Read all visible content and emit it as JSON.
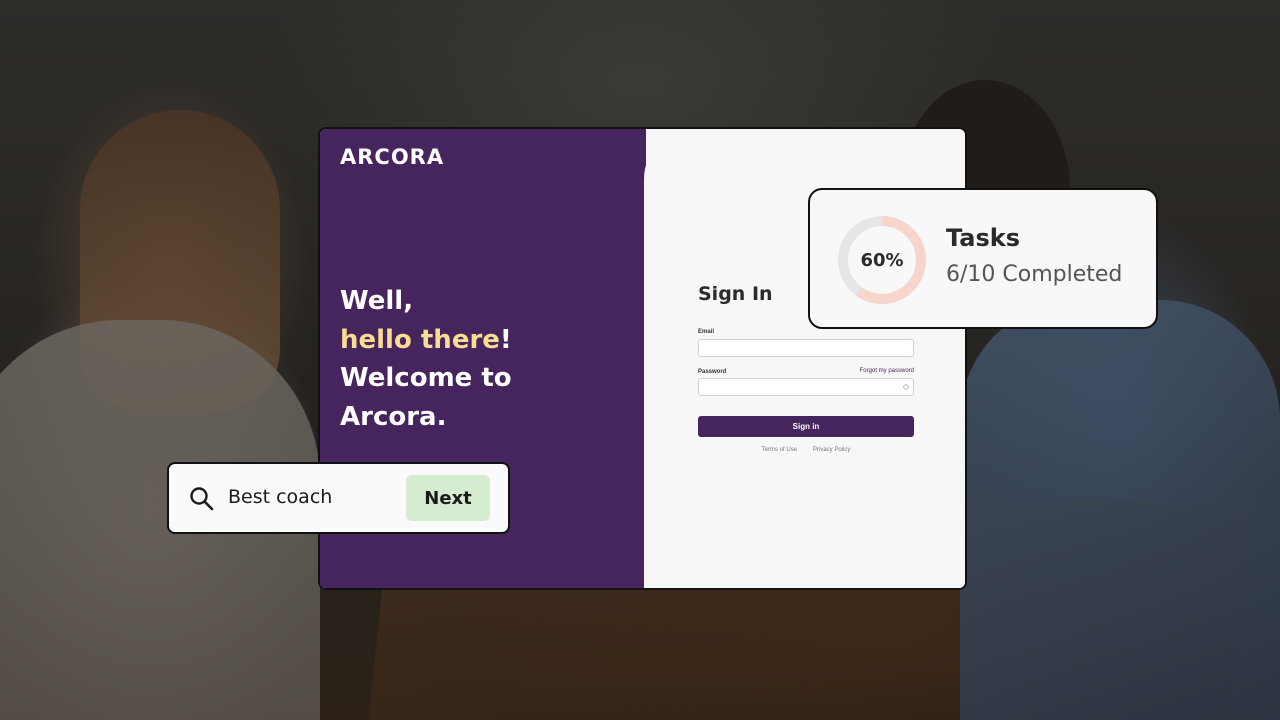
{
  "login": {
    "logo": "ARCORA",
    "welcome_line1": "Well,",
    "welcome_highlight": "hello there",
    "welcome_exclaim": "!",
    "welcome_line3": "Welcome to",
    "welcome_line4": "Arcora.",
    "signin_title": "Sign In",
    "email_label": "Email",
    "email_value": "",
    "password_label": "Password",
    "password_value": "",
    "forgot_link": "Forgot my password",
    "signin_button": "Sign in",
    "terms_link": "Terms of Use",
    "privacy_link": "Privacy Policy"
  },
  "tasks": {
    "percent_label": "60%",
    "progress": 0.6,
    "title": "Tasks",
    "subtitle": "6/10 Completed"
  },
  "search": {
    "query": "Best coach",
    "next_button": "Next"
  },
  "colors": {
    "brand_purple": "#46255f",
    "highlight_yellow": "#f9dd92",
    "donut_progress": "#f6d5cb",
    "donut_track": "#e6e6e6",
    "next_button_bg": "#d5ecd0"
  }
}
